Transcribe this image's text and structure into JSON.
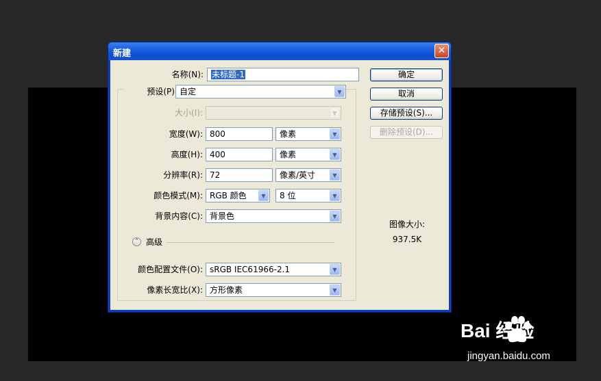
{
  "dialog": {
    "title": "新建",
    "close_glyph": "✕",
    "name_label": "名称(N):",
    "name_value": "未标题-1",
    "preset_label": "预设(P):",
    "preset_value": "自定",
    "size_label": "大小(I):",
    "size_value": "",
    "width_label": "宽度(W):",
    "width_value": "800",
    "width_unit": "像素",
    "height_label": "高度(H):",
    "height_value": "400",
    "height_unit": "像素",
    "resolution_label": "分辨率(R):",
    "resolution_value": "72",
    "resolution_unit": "像素/英寸",
    "color_mode_label": "颜色模式(M):",
    "color_mode_value": "RGB 颜色",
    "bit_depth_value": "8 位",
    "background_label": "背景内容(C):",
    "background_value": "背景色",
    "advanced_label": "高级",
    "color_profile_label": "颜色配置文件(O):",
    "color_profile_value": "sRGB IEC61966-2.1",
    "pixel_aspect_label": "像素长宽比(X):",
    "pixel_aspect_value": "方形像素",
    "image_size_label": "图像大小:",
    "image_size_value": "937.5K"
  },
  "buttons": {
    "ok": "确定",
    "cancel": "取消",
    "save_preset": "存储预设(S)...",
    "delete_preset": "删除预设(D)..."
  },
  "watermark": {
    "logo": "Bai  经验",
    "sub": "jingyan.baidu.com"
  },
  "colors": {
    "titlebar": "#1b5fe0",
    "client_bg": "#ece9d8",
    "selection": "#316ac5",
    "canvas": "#000000",
    "backdrop": "#282828"
  }
}
